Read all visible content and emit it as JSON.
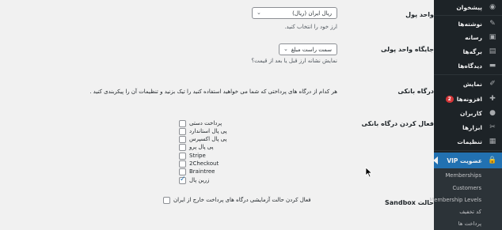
{
  "sidebar": {
    "items": [
      {
        "label": "پیشخوان",
        "icon": "dashboard-icon",
        "glyph": "◉"
      },
      {
        "label": "نوشته‌ها",
        "icon": "pin-icon",
        "glyph": "✎"
      },
      {
        "label": "رسانه",
        "icon": "media-icon",
        "glyph": "▣"
      },
      {
        "label": "برگه‌ها",
        "icon": "pages-icon",
        "glyph": "▤"
      },
      {
        "label": "دیدگاه‌ها",
        "icon": "comments-icon",
        "glyph": "▬"
      },
      {
        "label": "نمایش",
        "icon": "appearance-icon",
        "glyph": "✐"
      },
      {
        "label": "افزونه‌ها",
        "icon": "plugins-icon",
        "glyph": "✚",
        "badge": "2"
      },
      {
        "label": "کاربران",
        "icon": "users-icon",
        "glyph": "●"
      },
      {
        "label": "ابزارها",
        "icon": "tools-icon",
        "glyph": "✂"
      },
      {
        "label": "تنظیمات",
        "icon": "settings-icon",
        "glyph": "▦"
      },
      {
        "label": "عضویت VIP",
        "icon": "lock-icon",
        "glyph": "🔒"
      }
    ],
    "submenu": [
      "Memberships",
      "Customers",
      "Membership Levels",
      "کد تخفیف",
      "پرداخت ها"
    ]
  },
  "settings": {
    "currency": {
      "label": "واحد پول",
      "value": "ریال ایران (ریال)",
      "desc": "ارز خود را انتخاب کنید."
    },
    "currency_position": {
      "label": "جایگاه واحد پولی",
      "value": "سمت راست مبلغ",
      "desc": "نمایش نشانه ارز قبل یا بعد از قیمت؟"
    },
    "gateway": {
      "label": "درگاه بانکی",
      "desc": "هر کدام از درگاه های پرداختی که شما می خواهید استفاده کنید را تیک بزنید و تنظیمات آن را پیکربندی کنید ."
    },
    "enable_gateways": {
      "label": "فعال کردن درگاه بانکی",
      "options": [
        {
          "label": "پرداخت دستی",
          "checked": false
        },
        {
          "label": "پی پال استاندارد",
          "checked": false
        },
        {
          "label": "پی پال اکسپرس",
          "checked": false
        },
        {
          "label": "پی پال پرو",
          "checked": false
        },
        {
          "label": "Stripe",
          "checked": false
        },
        {
          "label": "2Checkout",
          "checked": false
        },
        {
          "label": "Braintree",
          "checked": false
        },
        {
          "label": "زرین پال",
          "checked": true
        }
      ]
    },
    "sandbox": {
      "label": "حالت Sandbox",
      "option": "فعال کردن حالت آزمایشی درگاه های پرداخت خارج از ایران",
      "checked": false
    }
  },
  "colors": {
    "sidebar_bg": "#1d2327",
    "active": "#2271b1",
    "badge": "#d63638"
  }
}
